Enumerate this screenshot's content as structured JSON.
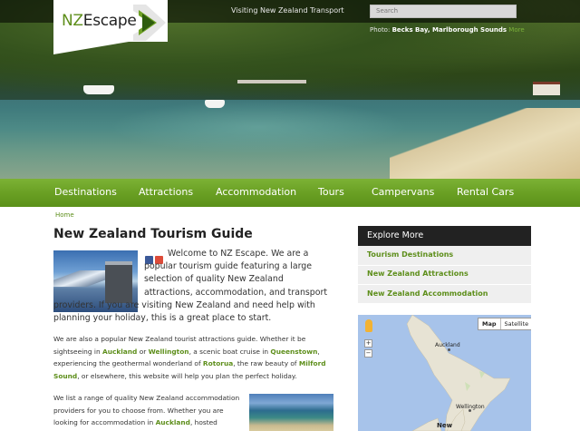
{
  "topbar": {
    "links": [
      "Visiting New Zealand",
      "Transport"
    ],
    "search_placeholder": "Search",
    "photo_label": "Photo:",
    "photo_location": "Becks Bay, Marlborough Sounds",
    "photo_more": "More"
  },
  "logo": {
    "prefix": "NZ",
    "name": "Escape"
  },
  "nav": [
    "Destinations",
    "Attractions",
    "Accommodation",
    "Tours",
    "Campervans",
    "Rental Cars"
  ],
  "breadcrumb": "Home",
  "main": {
    "title": "New Zealand Tourism Guide",
    "welcome": "Welcome to NZ Escape.",
    "intro": "We are a popular tourism guide featuring a large selection of quality New Zealand attractions, accommodation, and transport providers. If you are visiting New Zealand and need help with planning your holiday, this is a great place to start.",
    "p1": {
      "t1": "We are also a popular New Zealand tourist attractions guide. Whether it be sightseeing in ",
      "l1": "Auckland",
      "t2": " or ",
      "l2": "Wellington",
      "t3": ", a scenic boat cruise in ",
      "l3": "Queenstown",
      "t4": ", experiencing the geothermal wonderland of ",
      "l4": "Rotorua",
      "t5": ", the raw beauty of ",
      "l5": "Milford Sound",
      "t6": ", or elsewhere, this website will help you plan the perfect holiday."
    },
    "p2": {
      "t1": "We list a range of quality New Zealand accommodation providers for you to choose from. Whether you are looking for accommodation in ",
      "l1": "Auckland",
      "t2": ", hosted lodges / Bed and"
    }
  },
  "sidebar": {
    "explore_title": "Explore More",
    "items": [
      "Tourism Destinations",
      "New Zealand Attractions",
      "New Zealand Accommodation"
    ]
  },
  "map": {
    "map_btn": "Map",
    "satellite_btn": "Satellite",
    "zoom_in": "+",
    "zoom_out": "−",
    "cities": [
      "Auckland",
      "Wellington"
    ],
    "region": "New"
  },
  "colors": {
    "accent": "#5d8e1a",
    "nav_green": "#6aa024",
    "sidebar_head": "#222222"
  }
}
